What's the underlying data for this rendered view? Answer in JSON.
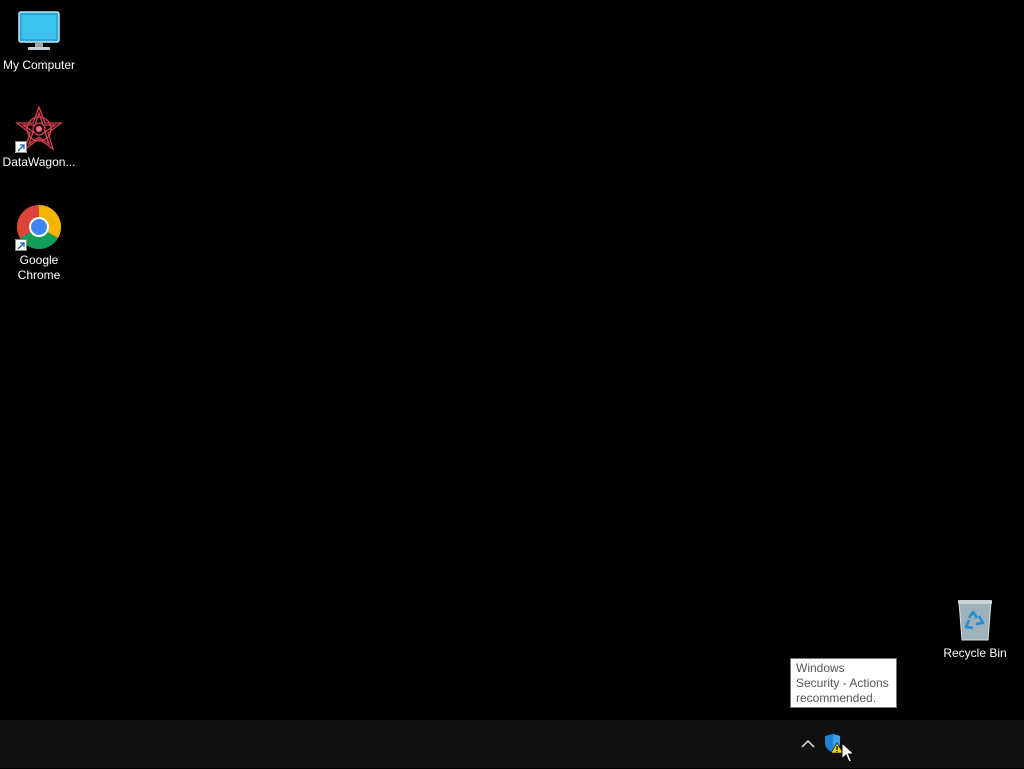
{
  "desktop": {
    "icons": [
      {
        "label": "My Computer",
        "icon": "monitor-icon"
      },
      {
        "label": "DataWagon...",
        "icon": "datawagon-icon"
      },
      {
        "label": "Google Chrome",
        "icon": "chrome-icon"
      },
      {
        "label": "Recycle Bin",
        "icon": "recycle-bin-icon"
      }
    ]
  },
  "tooltip": {
    "text": "Windows Security - Actions recommended."
  },
  "taskbar": {
    "tray": [
      {
        "icon": "chevron-up-icon"
      },
      {
        "icon": "windows-security-warning-icon"
      }
    ]
  },
  "colors": {
    "desktop_bg": "#000000",
    "taskbar_bg": "#101010",
    "tooltip_bg": "#ffffff",
    "tooltip_text": "#575757"
  }
}
